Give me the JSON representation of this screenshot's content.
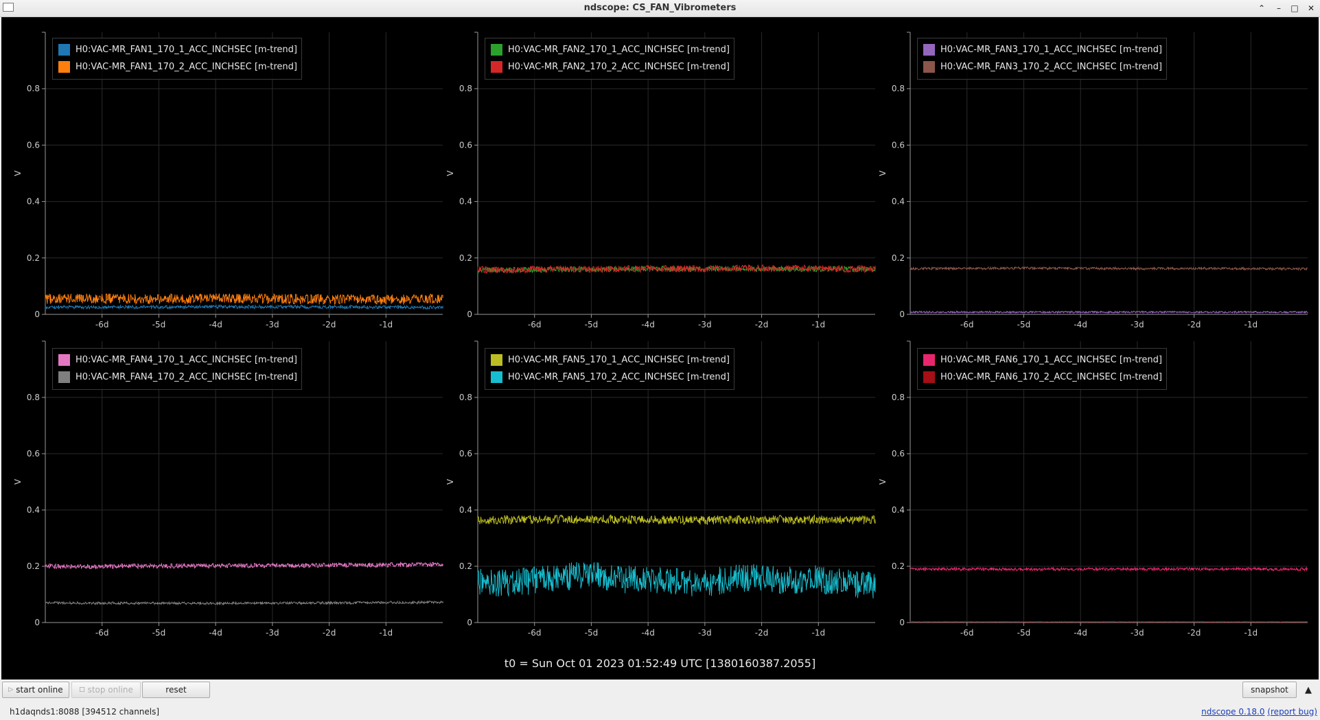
{
  "window": {
    "title": "ndscope: CS_FAN_Vibrometers"
  },
  "colors": {
    "background": "#000000",
    "grid": "#2a2a2a",
    "axis": "#9a9a9a",
    "tick_text": "#cccccc"
  },
  "chart_data": [
    {
      "type": "line",
      "ylabel": "V",
      "ylim": [
        0,
        1
      ],
      "xlim": [
        -7,
        0
      ],
      "xticks": [
        {
          "v": -6,
          "label": "-6d"
        },
        {
          "v": -5,
          "label": "-5d"
        },
        {
          "v": -4,
          "label": "-4d"
        },
        {
          "v": -3,
          "label": "-3d"
        },
        {
          "v": -2,
          "label": "-2d"
        },
        {
          "v": -1,
          "label": "-1d"
        }
      ],
      "yticks": [
        {
          "v": 0,
          "label": "0"
        },
        {
          "v": 0.2,
          "label": "0.2"
        },
        {
          "v": 0.4,
          "label": "0.4"
        },
        {
          "v": 0.6,
          "label": "0.6"
        },
        {
          "v": 0.8,
          "label": "0.8"
        }
      ],
      "series": [
        {
          "name": "H0:VAC-MR_FAN1_170_1_ACC_INCHSEC [m-trend]",
          "color": "#1f77b4",
          "x": [
            -7,
            -6,
            -5,
            -4,
            -3,
            -2,
            -1,
            0
          ],
          "y": [
            0.025,
            0.026,
            0.026,
            0.027,
            0.026,
            0.026,
            0.025,
            0.025
          ],
          "spread": 0.006
        },
        {
          "name": "H0:VAC-MR_FAN1_170_2_ACC_INCHSEC [m-trend]",
          "color": "#ff7f0e",
          "x": [
            -7,
            -6,
            -5,
            -4,
            -3,
            -2,
            -1,
            0
          ],
          "y": [
            0.055,
            0.056,
            0.054,
            0.057,
            0.055,
            0.053,
            0.052,
            0.054
          ],
          "spread": 0.018
        }
      ]
    },
    {
      "type": "line",
      "ylabel": "V",
      "ylim": [
        0,
        1
      ],
      "xlim": [
        -7,
        0
      ],
      "xticks": [
        {
          "v": -6,
          "label": "-6d"
        },
        {
          "v": -5,
          "label": "-5d"
        },
        {
          "v": -4,
          "label": "-4d"
        },
        {
          "v": -3,
          "label": "-3d"
        },
        {
          "v": -2,
          "label": "-2d"
        },
        {
          "v": -1,
          "label": "-1d"
        }
      ],
      "yticks": [
        {
          "v": 0,
          "label": "0"
        },
        {
          "v": 0.2,
          "label": "0.2"
        },
        {
          "v": 0.4,
          "label": "0.4"
        },
        {
          "v": 0.6,
          "label": "0.6"
        },
        {
          "v": 0.8,
          "label": "0.8"
        }
      ],
      "series": [
        {
          "name": "H0:VAC-MR_FAN2_170_1_ACC_INCHSEC [m-trend]",
          "color": "#2ca02c",
          "x": [
            -7,
            -6,
            -5,
            -4,
            -3,
            -2,
            -1,
            0
          ],
          "y": [
            0.157,
            0.158,
            0.16,
            0.162,
            0.161,
            0.163,
            0.161,
            0.16
          ],
          "spread": 0.01
        },
        {
          "name": "H0:VAC-MR_FAN2_170_2_ACC_INCHSEC [m-trend]",
          "color": "#d62728",
          "x": [
            -7,
            -6,
            -5,
            -4,
            -3,
            -2,
            -1,
            0
          ],
          "y": [
            0.158,
            0.159,
            0.16,
            0.162,
            0.162,
            0.164,
            0.162,
            0.161
          ],
          "spread": 0.012
        }
      ]
    },
    {
      "type": "line",
      "ylabel": "V",
      "ylim": [
        0,
        1
      ],
      "xlim": [
        -7,
        0
      ],
      "xticks": [
        {
          "v": -6,
          "label": "-6d"
        },
        {
          "v": -5,
          "label": "-5d"
        },
        {
          "v": -4,
          "label": "-4d"
        },
        {
          "v": -3,
          "label": "-3d"
        },
        {
          "v": -2,
          "label": "-2d"
        },
        {
          "v": -1,
          "label": "-1d"
        }
      ],
      "yticks": [
        {
          "v": 0,
          "label": "0"
        },
        {
          "v": 0.2,
          "label": "0.2"
        },
        {
          "v": 0.4,
          "label": "0.4"
        },
        {
          "v": 0.6,
          "label": "0.6"
        },
        {
          "v": 0.8,
          "label": "0.8"
        }
      ],
      "series": [
        {
          "name": "H0:VAC-MR_FAN3_170_1_ACC_INCHSEC [m-trend]",
          "color": "#9467bd",
          "x": [
            -7,
            -6,
            -5,
            -4,
            -3,
            -2,
            -1,
            0
          ],
          "y": [
            0.008,
            0.008,
            0.008,
            0.008,
            0.008,
            0.008,
            0.008,
            0.008
          ],
          "spread": 0.003
        },
        {
          "name": "H0:VAC-MR_FAN3_170_2_ACC_INCHSEC [m-trend]",
          "color": "#8c564b",
          "x": [
            -7,
            -6,
            -5,
            -4,
            -3,
            -2,
            -1,
            0
          ],
          "y": [
            0.162,
            0.163,
            0.164,
            0.163,
            0.162,
            0.163,
            0.162,
            0.161
          ],
          "spread": 0.004
        }
      ]
    },
    {
      "type": "line",
      "ylabel": "V",
      "ylim": [
        0,
        1
      ],
      "xlim": [
        -7,
        0
      ],
      "xticks": [
        {
          "v": -6,
          "label": "-6d"
        },
        {
          "v": -5,
          "label": "-5d"
        },
        {
          "v": -4,
          "label": "-4d"
        },
        {
          "v": -3,
          "label": "-3d"
        },
        {
          "v": -2,
          "label": "-2d"
        },
        {
          "v": -1,
          "label": "-1d"
        }
      ],
      "yticks": [
        {
          "v": 0,
          "label": "0"
        },
        {
          "v": 0.2,
          "label": "0.2"
        },
        {
          "v": 0.4,
          "label": "0.4"
        },
        {
          "v": 0.6,
          "label": "0.6"
        },
        {
          "v": 0.8,
          "label": "0.8"
        }
      ],
      "series": [
        {
          "name": "H0:VAC-MR_FAN4_170_1_ACC_INCHSEC [m-trend]",
          "color": "#e377c2",
          "x": [
            -7,
            -6,
            -5,
            -4,
            -3,
            -2,
            -1,
            0
          ],
          "y": [
            0.2,
            0.2,
            0.201,
            0.202,
            0.203,
            0.204,
            0.205,
            0.206
          ],
          "spread": 0.008
        },
        {
          "name": "H0:VAC-MR_FAN4_170_2_ACC_INCHSEC [m-trend]",
          "color": "#7f7f7f",
          "x": [
            -7,
            -6,
            -5,
            -4,
            -3,
            -2,
            -1,
            0
          ],
          "y": [
            0.07,
            0.069,
            0.069,
            0.068,
            0.069,
            0.07,
            0.071,
            0.072
          ],
          "spread": 0.004
        }
      ]
    },
    {
      "type": "line",
      "ylabel": "V",
      "ylim": [
        0,
        1
      ],
      "xlim": [
        -7,
        0
      ],
      "xticks": [
        {
          "v": -6,
          "label": "-6d"
        },
        {
          "v": -5,
          "label": "-5d"
        },
        {
          "v": -4,
          "label": "-4d"
        },
        {
          "v": -3,
          "label": "-3d"
        },
        {
          "v": -2,
          "label": "-2d"
        },
        {
          "v": -1,
          "label": "-1d"
        }
      ],
      "yticks": [
        {
          "v": 0,
          "label": "0"
        },
        {
          "v": 0.2,
          "label": "0.2"
        },
        {
          "v": 0.4,
          "label": "0.4"
        },
        {
          "v": 0.6,
          "label": "0.6"
        },
        {
          "v": 0.8,
          "label": "0.8"
        }
      ],
      "series": [
        {
          "name": "H0:VAC-MR_FAN5_170_1_ACC_INCHSEC [m-trend]",
          "color": "#bcbd22",
          "x": [
            -7,
            -6,
            -5,
            -4,
            -3,
            -2,
            -1,
            0
          ],
          "y": [
            0.365,
            0.366,
            0.367,
            0.365,
            0.364,
            0.366,
            0.365,
            0.364
          ],
          "spread": 0.016
        },
        {
          "name": "H0:VAC-MR_FAN5_170_2_ACC_INCHSEC [m-trend]",
          "color": "#17becf",
          "x": [
            -7,
            -6.5,
            -6,
            -5.5,
            -5,
            -4.5,
            -4,
            -3.5,
            -3,
            -2.5,
            -2,
            -1.5,
            -1,
            -0.5,
            0
          ],
          "y": [
            0.145,
            0.14,
            0.15,
            0.16,
            0.175,
            0.155,
            0.15,
            0.145,
            0.14,
            0.155,
            0.16,
            0.15,
            0.155,
            0.14,
            0.13
          ],
          "spread": 0.05
        }
      ]
    },
    {
      "type": "line",
      "ylabel": "V",
      "ylim": [
        0,
        1
      ],
      "xlim": [
        -7,
        0
      ],
      "xticks": [
        {
          "v": -6,
          "label": "-6d"
        },
        {
          "v": -5,
          "label": "-5d"
        },
        {
          "v": -4,
          "label": "-4d"
        },
        {
          "v": -3,
          "label": "-3d"
        },
        {
          "v": -2,
          "label": "-2d"
        },
        {
          "v": -1,
          "label": "-1d"
        }
      ],
      "yticks": [
        {
          "v": 0,
          "label": "0"
        },
        {
          "v": 0.2,
          "label": "0.2"
        },
        {
          "v": 0.4,
          "label": "0.4"
        },
        {
          "v": 0.6,
          "label": "0.6"
        },
        {
          "v": 0.8,
          "label": "0.8"
        }
      ],
      "series": [
        {
          "name": "H0:VAC-MR_FAN6_170_1_ACC_INCHSEC [m-trend]",
          "color": "#e8266e",
          "x": [
            -7,
            -6,
            -5,
            -4,
            -3,
            -2,
            -1,
            0
          ],
          "y": [
            0.19,
            0.19,
            0.19,
            0.19,
            0.19,
            0.19,
            0.19,
            0.19
          ],
          "spread": 0.005
        },
        {
          "name": "H0:VAC-MR_FAN6_170_2_ACC_INCHSEC [m-trend]",
          "color": "#a50f15",
          "x": [
            -7,
            -6,
            -5,
            -4,
            -3,
            -2,
            -1,
            0
          ],
          "y": [
            0.003,
            0.003,
            0.003,
            0.003,
            0.003,
            0.003,
            0.003,
            0.003
          ],
          "spread": 0.001
        }
      ]
    }
  ],
  "t0_label": "t0 = Sun Oct 01 2023 01:52:49 UTC [1380160387.2055]",
  "toolbar": {
    "start_online": "start online",
    "stop_online": "stop online",
    "reset": "reset",
    "snapshot": "snapshot"
  },
  "status": {
    "server": "h1daqnds1:8088  [394512 channels]",
    "version_link": "ndscope 0.18.0",
    "report_bug": "(report bug)"
  }
}
